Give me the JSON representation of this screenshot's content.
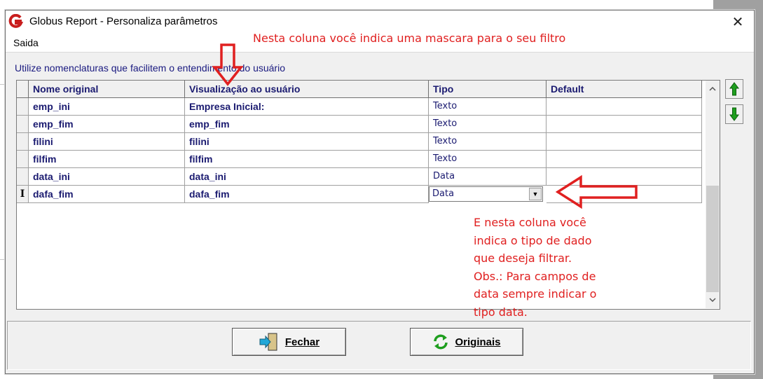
{
  "window": {
    "title": "Globus Report - Personaliza parâmetros",
    "close_glyph": "✕"
  },
  "menu": {
    "items": [
      "Saida"
    ]
  },
  "hint": "Utilize nomenclaturas que facilitem o entendimento do usuário",
  "grid": {
    "columns": [
      "Nome original",
      "Visualização ao usuário",
      "Tipo",
      "Default"
    ],
    "rows": [
      {
        "indicator": "",
        "nome": "emp_ini",
        "visual": "Empresa Inicial:",
        "tipo": "Texto",
        "default": ""
      },
      {
        "indicator": "",
        "nome": "emp_fim",
        "visual": "emp_fim",
        "tipo": "Texto",
        "default": ""
      },
      {
        "indicator": "",
        "nome": "filini",
        "visual": "filini",
        "tipo": "Texto",
        "default": ""
      },
      {
        "indicator": "",
        "nome": "filfim",
        "visual": "filfim",
        "tipo": "Texto",
        "default": ""
      },
      {
        "indicator": "",
        "nome": "data_ini",
        "visual": "data_ini",
        "tipo": "Data",
        "default": ""
      },
      {
        "indicator": "I",
        "nome": "dafa_fim",
        "visual": "dafa_fim",
        "tipo": "Data",
        "default": "",
        "editing": true
      }
    ]
  },
  "buttons": {
    "fechar": "Fechar",
    "originais": "Originais"
  },
  "icons": {
    "app": "globus-logo-icon",
    "move_up": "green-up-arrow-icon",
    "move_down": "green-down-arrow-icon",
    "fechar": "exit-door-icon",
    "originais": "refresh-icon"
  },
  "annotations": {
    "top": "Nesta coluna você indica uma mascara para o seu filtro",
    "side": "E nesta coluna você\nindica o tipo de dado\nque deseja filtrar.\nObs.: Para campos de\ndata sempre indicar o\ntipo data."
  },
  "colors": {
    "annotation": "#e02020",
    "grid_text": "#1a1a70",
    "arrow_green": "#1e9e1e"
  }
}
